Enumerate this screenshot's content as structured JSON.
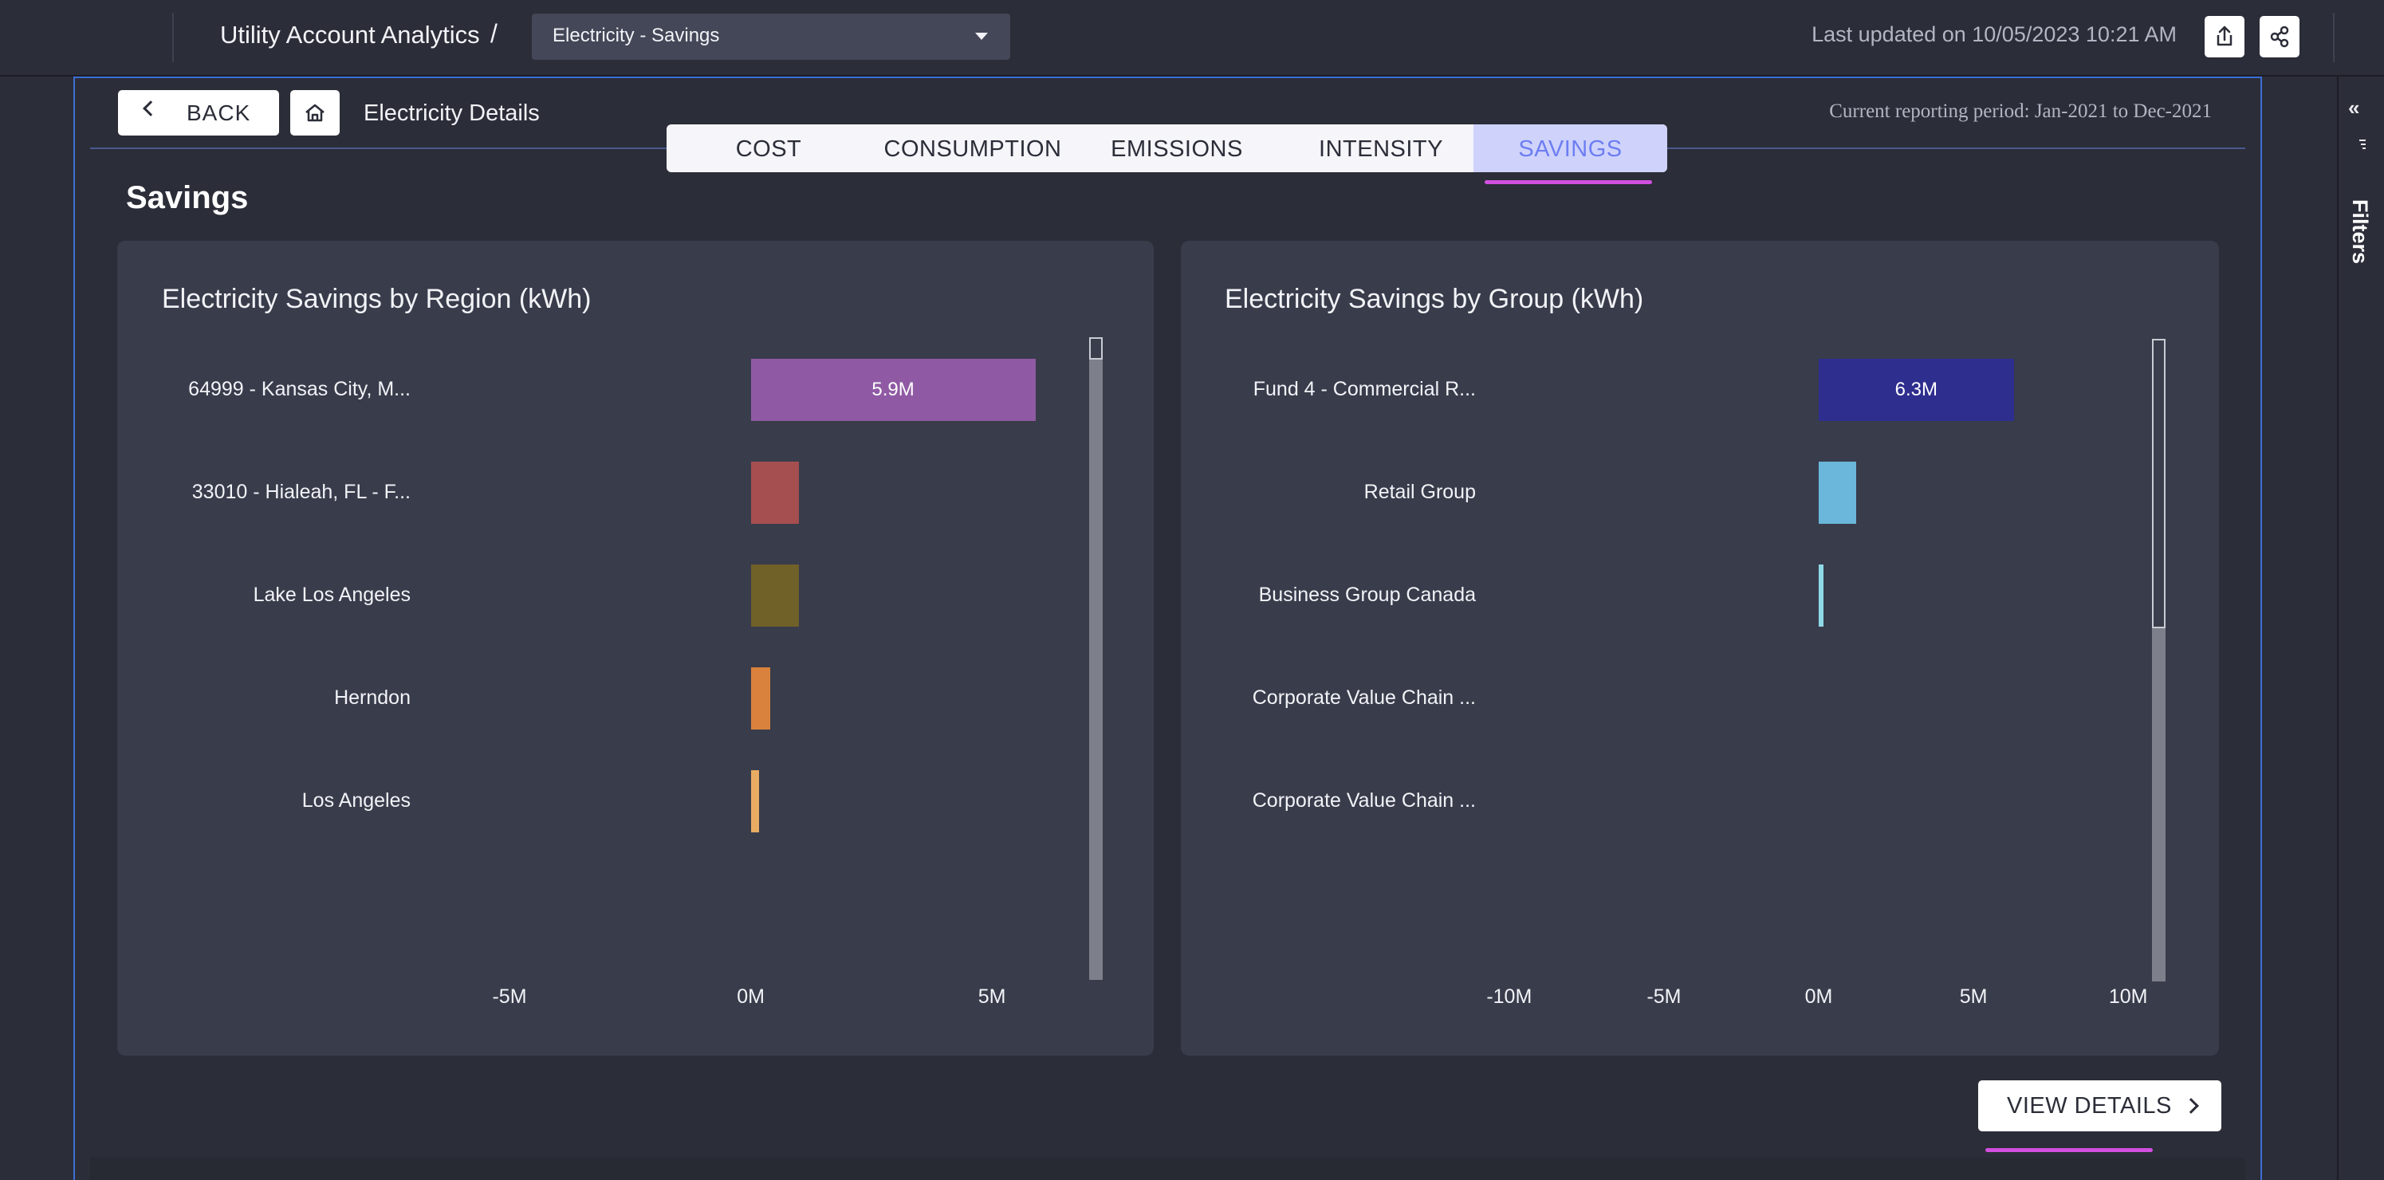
{
  "header": {
    "app_title": "Utility Account Analytics",
    "breadcrumb_separator": "/",
    "dataset_select": "Electricity - Savings",
    "last_updated": "Last updated on 10/05/2023 10:21 AM",
    "export_icon": "export-icon",
    "share_icon": "share-icon"
  },
  "subheader": {
    "back_label": "BACK",
    "home_icon": "home-icon",
    "page_heading": "Electricity Details",
    "reporting_period": "Current reporting period: Jan-2021 to Dec-2021"
  },
  "tabs": [
    {
      "label": "COST"
    },
    {
      "label": "CONSUMPTION"
    },
    {
      "label": "EMISSIONS"
    },
    {
      "label": "INTENSITY"
    },
    {
      "label": "SAVINGS",
      "active": true
    }
  ],
  "section_title": "Savings",
  "filters": {
    "label": "Filters",
    "collapse_icon": "double-chevron-left-icon",
    "icon": "filter-icon"
  },
  "view_details_label": "VIEW DETAILS",
  "colors": {
    "accent": "#d24fe0",
    "active_tab_bg": "#cfd3fb",
    "active_tab_text": "#6d7ef2",
    "frame_border": "#3c6fd6"
  },
  "chart_data": [
    {
      "type": "bar",
      "orientation": "horizontal",
      "title": "Electricity Savings by Region (kWh)",
      "categories": [
        "64999 - Kansas City, M...",
        "33010 - Hialeah, FL - F...",
        "Lake Los Angeles",
        "Herndon",
        "Los Angeles"
      ],
      "values": [
        5900000,
        1000000,
        1000000,
        400000,
        180000
      ],
      "colors": [
        "#8f5aa3",
        "#a64f50",
        "#6f6128",
        "#d9823e",
        "#e8ac63"
      ],
      "data_labels": [
        "5.9M",
        "",
        "",
        "",
        ""
      ],
      "xlim": [
        -7000000,
        6700000
      ],
      "xticks": [
        {
          "value": -5000000,
          "label": "-5M"
        },
        {
          "value": 0,
          "label": "0M"
        },
        {
          "value": 5000000,
          "label": "5M"
        }
      ]
    },
    {
      "type": "bar",
      "orientation": "horizontal",
      "title": "Electricity Savings by Group (kWh)",
      "categories": [
        "Fund 4 - Commercial R...",
        "Retail Group",
        "Business Group Canada",
        "Corporate Value Chain ...",
        "Corporate Value Chain ..."
      ],
      "values": [
        6300000,
        1200000,
        150000,
        0,
        0
      ],
      "colors": [
        "#2e2e8f",
        "#6ab7db",
        "#8fd8e6",
        "#8fd8e6",
        "#8fd8e6"
      ],
      "data_labels": [
        "6.3M",
        "",
        "",
        "",
        ""
      ],
      "xlim": [
        -11000000,
        11000000
      ],
      "xticks": [
        {
          "value": -10000000,
          "label": "-10M"
        },
        {
          "value": -5000000,
          "label": "-5M"
        },
        {
          "value": 0,
          "label": "0M"
        },
        {
          "value": 5000000,
          "label": "5M"
        },
        {
          "value": 10000000,
          "label": "10M"
        }
      ]
    }
  ]
}
